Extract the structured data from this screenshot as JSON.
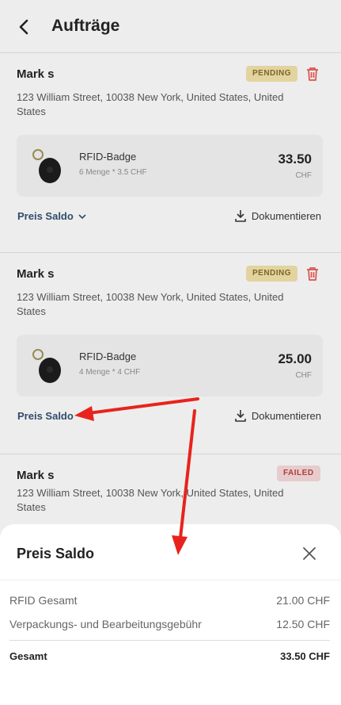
{
  "header": {
    "title": "Aufträge"
  },
  "orders": [
    {
      "name": "Mark s",
      "status": "PENDING",
      "address": "123 William Street, 10038 New York, United States, United States",
      "product": {
        "name": "RFID-Badge",
        "detail": "6 Menge * 3.5 CHF",
        "price": "33.50",
        "currency": "CHF"
      },
      "saldo_label": "Preis Saldo",
      "doc_label": "Dokumentieren"
    },
    {
      "name": "Mark s",
      "status": "PENDING",
      "address": "123 William Street, 10038 New York, United States, United States",
      "product": {
        "name": "RFID-Badge",
        "detail": "4 Menge * 4 CHF",
        "price": "25.00",
        "currency": "CHF"
      },
      "saldo_label": "Preis Saldo",
      "doc_label": "Dokumentieren"
    },
    {
      "name": "Mark s",
      "status": "FAILED",
      "address": "123 William Street, 10038 New York, United States, United States"
    }
  ],
  "sheet": {
    "title": "Preis Saldo",
    "rows": [
      {
        "label": "RFID Gesamt",
        "value": "21.00 CHF"
      },
      {
        "label": "Verpackungs- und Bearbeitungsgebühr",
        "value": "12.50 CHF"
      }
    ],
    "total": {
      "label": "Gesamt",
      "value": "33.50 CHF"
    }
  },
  "colors": {
    "accent_link": "#2f4d6b",
    "pending_bg": "#e2d39f",
    "failed_bg": "#e6cccc",
    "annotation_red": "#e8231d"
  }
}
